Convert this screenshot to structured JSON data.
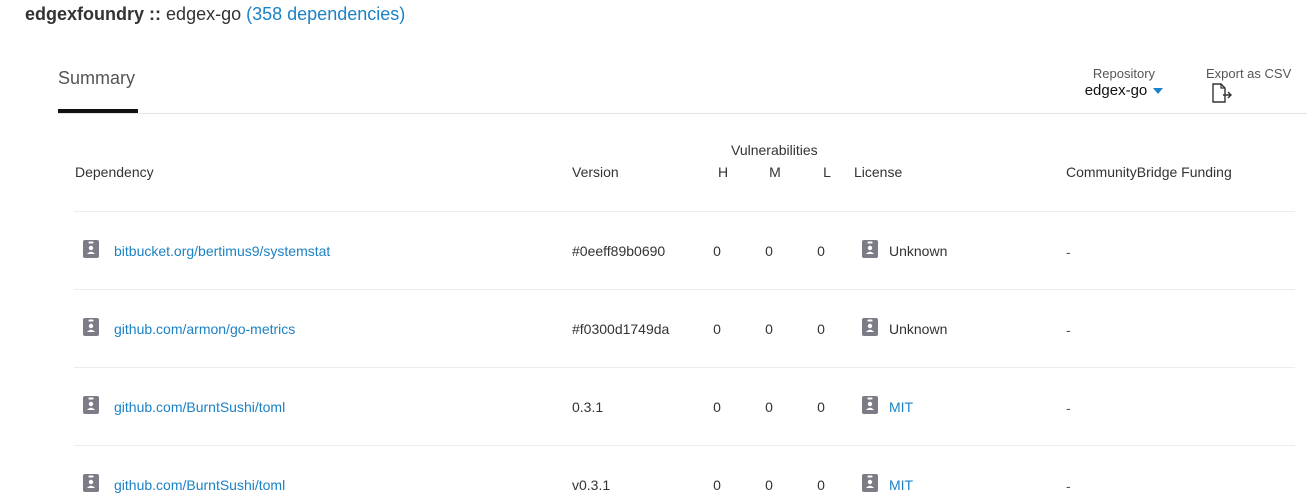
{
  "header": {
    "org": "edgexfoundry",
    "separator": "::",
    "repo": "edgex-go",
    "dependencies_link": "(358 dependencies)"
  },
  "tabs": {
    "summary": "Summary"
  },
  "repository_select": {
    "label": "Repository",
    "value": "edgex-go"
  },
  "export": {
    "label": "Export as CSV",
    "icon": "export-file-icon"
  },
  "table": {
    "headers": {
      "dependency": "Dependency",
      "version": "Version",
      "vulnerabilities": "Vulnerabilities",
      "high": "H",
      "medium": "M",
      "low": "L",
      "license": "License",
      "funding": "CommunityBridge Funding"
    },
    "rows": [
      {
        "dependency": "bitbucket.org/bertimus9/systemstat",
        "version": "#0eeff89b0690",
        "h": "0",
        "m": "0",
        "l": "0",
        "license": "Unknown",
        "license_link": false,
        "funding": "-"
      },
      {
        "dependency": "github.com/armon/go-metrics",
        "version": "#f0300d1749da",
        "h": "0",
        "m": "0",
        "l": "0",
        "license": "Unknown",
        "license_link": false,
        "funding": "-"
      },
      {
        "dependency": "github.com/BurntSushi/toml",
        "version": "0.3.1",
        "h": "0",
        "m": "0",
        "l": "0",
        "license": "MIT",
        "license_link": true,
        "funding": "-"
      },
      {
        "dependency": "github.com/BurntSushi/toml",
        "version": "v0.3.1",
        "h": "0",
        "m": "0",
        "l": "0",
        "license": "MIT",
        "license_link": true,
        "funding": "-"
      }
    ]
  },
  "colors": {
    "link": "#1b82c5",
    "icon_gray": "#7c7c86"
  }
}
